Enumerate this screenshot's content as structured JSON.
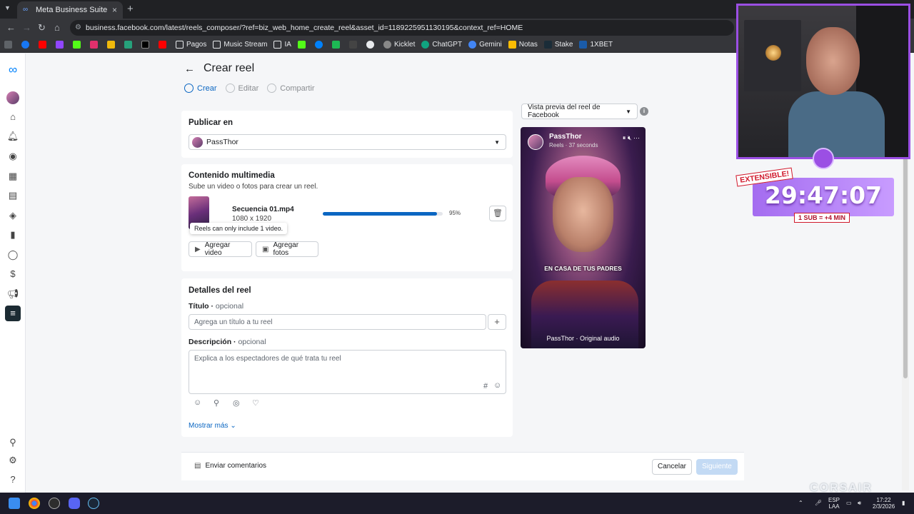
{
  "browser": {
    "tab_title": "Meta Business Suite",
    "url": "business.facebook.com/latest/reels_composer/?ref=biz_web_home_create_reel&asset_id=1189225951130195&context_ref=HOME",
    "bookmarks": [
      "Pagos",
      "Music Stream",
      "IA",
      "Kicklet",
      "ChatGPT",
      "Gemini",
      "Notas",
      "Stake",
      "1XBET"
    ]
  },
  "page": {
    "title": "Crear reel",
    "steps": [
      "Crear",
      "Editar",
      "Compartir"
    ],
    "active_step": 0
  },
  "publish": {
    "heading": "Publicar en",
    "account": "PassThor"
  },
  "media": {
    "heading": "Contenido multimedia",
    "subtitle": "Sube un video o fotos para crear un reel.",
    "file_name": "Secuencia 01.mp4",
    "file_dims": "1080 x 1920",
    "progress": 0.95,
    "progress_label": "95%",
    "tooltip": "Reels can only include 1 video.",
    "add_video": "Agregar video",
    "add_photos": "Agregar fotos"
  },
  "details": {
    "heading": "Detalles del reel",
    "title_label": "Título",
    "optional": "opcional",
    "title_placeholder": "Agrega un título a tu reel",
    "desc_label": "Descripción",
    "desc_placeholder": "Explica a los espectadores de qué trata tu reel",
    "show_more": "Mostrar más"
  },
  "preview": {
    "selector": "Vista previa del reel de Facebook",
    "name": "PassThor",
    "meta": "Reels · 37 seconds",
    "caption": "EN CASA DE TUS PADRES",
    "audio": "PassThor · Original audio"
  },
  "footer": {
    "feedback": "Enviar comentarios",
    "cancel": "Cancelar",
    "next": "Siguiente"
  },
  "overlay": {
    "extensible": "EXTENSIBLE!",
    "timer": "29:47:07",
    "sub_rate": "1 SUB = +4 MIN",
    "brand": "CORSAIR"
  },
  "taskbar": {
    "lang_top": "ESP",
    "lang_bottom": "LAA",
    "time": "17:22",
    "date": "2/3/2026"
  },
  "colors": {
    "accent": "#0a66c2",
    "stream_purple": "#9b4fe4"
  }
}
